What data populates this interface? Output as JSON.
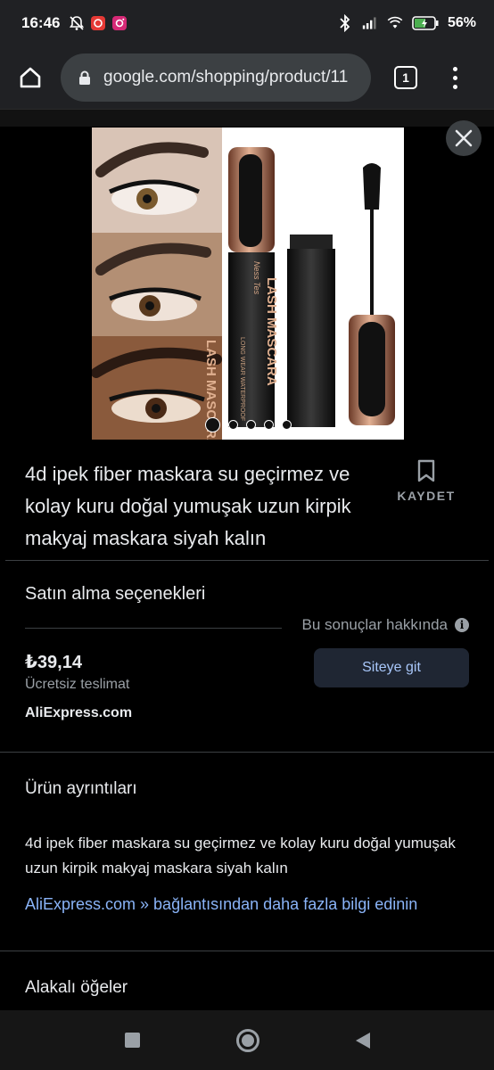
{
  "status_bar": {
    "time": "16:46",
    "battery_percent": "56%"
  },
  "browser": {
    "url": "google.com/shopping/product/11",
    "tab_count": "1"
  },
  "product": {
    "image_dots_total": 5,
    "image_dots_active": 1,
    "title": "4d ipek fiber maskara su geçirmez ve kolay kuru doğal yumuşak uzun kirpik makyaj maskara siyah kalın",
    "save_label": "KAYDET",
    "image_text": {
      "brand_script": "Ness Tes",
      "product_name": "LASH MASCARA",
      "sub_text": "LONG WEAR WATERPROOF"
    }
  },
  "purchase": {
    "section_title": "Satın alma seçenekleri",
    "about_results": "Bu sonuçlar hakkında",
    "price": "₺39,14",
    "shipping": "Ücretsiz teslimat",
    "merchant": "AliExpress.com",
    "visit_button": "Siteye git"
  },
  "details": {
    "section_title": "Ürün ayrıntıları",
    "description": "4d ipek fiber maskara su geçirmez ve kolay kuru doğal yumuşak uzun kirpik makyaj maskara siyah kalın",
    "more_link": "AliExpress.com » bağlantısından daha fazla bilgi edinin"
  },
  "related": {
    "section_title": "Alakalı öğeler"
  },
  "colors": {
    "background": "#000000",
    "link": "#8ab4f8",
    "button_bg": "#1f2633",
    "button_text": "#a8c7fa",
    "muted_text": "#9aa0a6"
  }
}
